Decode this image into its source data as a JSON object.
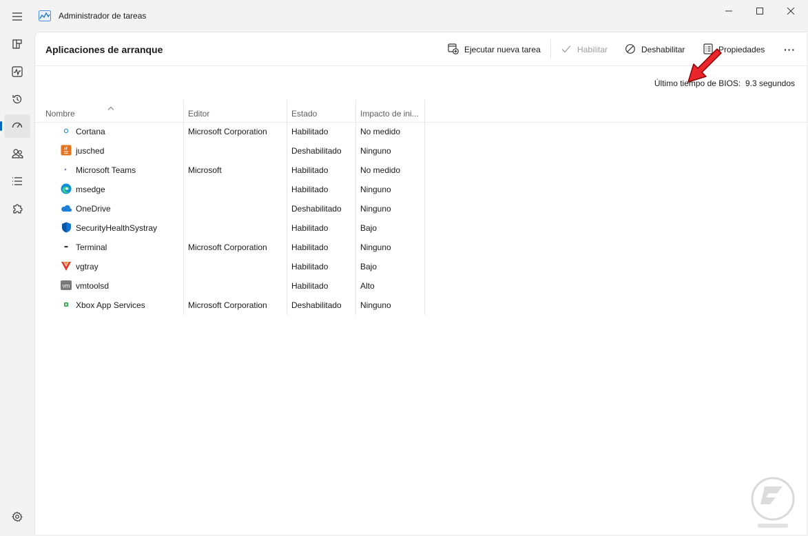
{
  "window": {
    "title": "Administrador de tareas"
  },
  "nav": {
    "items": [
      {
        "name": "processes",
        "icon": "grid-icon"
      },
      {
        "name": "performance",
        "icon": "performance-chart-icon"
      },
      {
        "name": "app-history",
        "icon": "history-icon"
      },
      {
        "name": "startup-apps",
        "icon": "speedometer-icon",
        "active": true
      },
      {
        "name": "users",
        "icon": "users-icon"
      },
      {
        "name": "details",
        "icon": "list-icon"
      },
      {
        "name": "services",
        "icon": "puzzle-icon"
      }
    ],
    "settings_icon": "gear-icon"
  },
  "page": {
    "title": "Aplicaciones de arranque"
  },
  "toolbar": {
    "run_new_task": "Ejecutar nueva tarea",
    "enable": "Habilitar",
    "disable": "Deshabilitar",
    "properties": "Propiedades",
    "more": "···"
  },
  "bios": {
    "label": "Último tiempo de BIOS:",
    "value": "9.3 segundos"
  },
  "table": {
    "columns": [
      "Nombre",
      "Editor",
      "Estado",
      "Impacto de ini..."
    ],
    "rows": [
      {
        "icon": "cortana-icon",
        "name": "Cortana",
        "editor": "Microsoft Corporation",
        "state": "Habilitado",
        "impact": "No medido"
      },
      {
        "icon": "java-icon",
        "name": "jusched",
        "editor": "",
        "state": "Deshabilitado",
        "impact": "Ninguno"
      },
      {
        "icon": "teams-icon",
        "name": "Microsoft Teams",
        "editor": "Microsoft",
        "state": "Habilitado",
        "impact": "No medido"
      },
      {
        "icon": "edge-icon",
        "name": "msedge",
        "editor": "",
        "state": "Habilitado",
        "impact": "Ninguno"
      },
      {
        "icon": "onedrive-icon",
        "name": "OneDrive",
        "editor": "",
        "state": "Deshabilitado",
        "impact": "Ninguno"
      },
      {
        "icon": "shield-icon",
        "name": "SecurityHealthSystray",
        "editor": "",
        "state": "Habilitado",
        "impact": "Bajo"
      },
      {
        "icon": "terminal-icon",
        "name": "Terminal",
        "editor": "Microsoft Corporation",
        "state": "Habilitado",
        "impact": "Ninguno"
      },
      {
        "icon": "vgtray-icon",
        "name": "vgtray",
        "editor": "",
        "state": "Habilitado",
        "impact": "Bajo"
      },
      {
        "icon": "vmware-icon",
        "name": "vmtoolsd",
        "editor": "",
        "state": "Habilitado",
        "impact": "Alto"
      },
      {
        "icon": "xbox-icon",
        "name": "Xbox App Services",
        "editor": "Microsoft Corporation",
        "state": "Deshabilitado",
        "impact": "Ninguno"
      }
    ]
  },
  "colors": {
    "accent": "#0067c0",
    "highlight_arrow": "#e8262b"
  }
}
